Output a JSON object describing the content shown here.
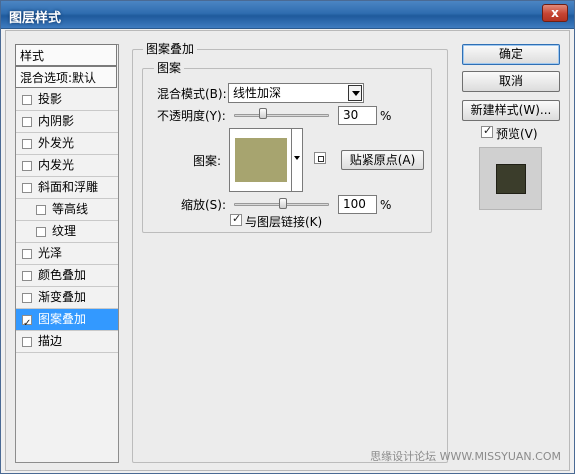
{
  "window": {
    "title": "图层样式",
    "close_glyph": "x"
  },
  "left_list": {
    "header": "样式",
    "blend": "混合选项:默认",
    "items": [
      {
        "label": "投影",
        "checked": false
      },
      {
        "label": "内阴影",
        "checked": false
      },
      {
        "label": "外发光",
        "checked": false
      },
      {
        "label": "内发光",
        "checked": false
      },
      {
        "label": "斜面和浮雕",
        "checked": false
      },
      {
        "label": "等高线",
        "checked": false
      },
      {
        "label": "纹理",
        "checked": false
      },
      {
        "label": "光泽",
        "checked": false
      },
      {
        "label": "颜色叠加",
        "checked": false
      },
      {
        "label": "渐变叠加",
        "checked": false
      },
      {
        "label": "图案叠加",
        "checked": true,
        "selected": true
      },
      {
        "label": "描边",
        "checked": false
      }
    ]
  },
  "panel": {
    "group_title": "图案叠加",
    "subgroup_title": "图案",
    "blend_mode_label": "混合模式(B):",
    "blend_mode_value": "线性加深",
    "opacity_label": "不透明度(Y):",
    "opacity_value": "30",
    "opacity_percent": 30,
    "opacity_unit": "%",
    "pattern_label": "图案:",
    "snap_origin_label": "贴紧原点(A)",
    "scale_label": "缩放(S):",
    "scale_value": "100",
    "scale_percent": 100,
    "scale_unit": "%",
    "link_layer_label": "与图层链接(K)",
    "link_layer_checked": true
  },
  "right_buttons": {
    "ok": "确定",
    "cancel": "取消",
    "new_style": "新建样式(W)...",
    "preview_label": "预览(V)",
    "preview_checked": true
  },
  "watermark": "思缘设计论坛 WWW.MISSYUAN.COM",
  "colors": {
    "selection": "#3399ff",
    "pattern": "#a7a46f",
    "preview": "#3b3d2b",
    "titlebar": "#2f6db0"
  }
}
